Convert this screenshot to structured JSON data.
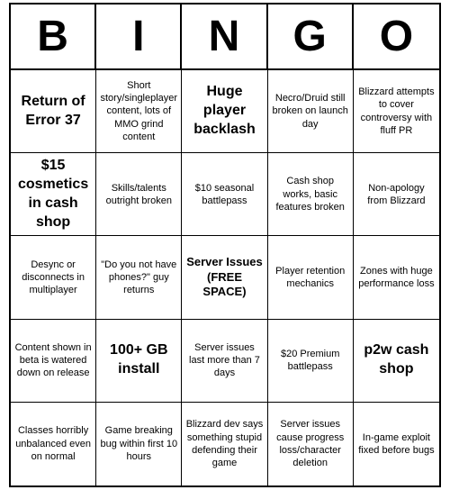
{
  "header": {
    "letters": [
      "B",
      "I",
      "N",
      "G",
      "O"
    ]
  },
  "cells": [
    {
      "text": "Return of Error 37",
      "large": true
    },
    {
      "text": "Short story/singleplayer content, lots of MMO grind content",
      "large": false
    },
    {
      "text": "Huge player backlash",
      "large": true
    },
    {
      "text": "Necro/Druid still broken on launch day",
      "large": false
    },
    {
      "text": "Blizzard attempts to cover controversy with fluff PR",
      "large": false
    },
    {
      "text": "$15 cosmetics in cash shop",
      "large": true
    },
    {
      "text": "Skills/talents outright broken",
      "large": false
    },
    {
      "text": "$10 seasonal battlepass",
      "large": false
    },
    {
      "text": "Cash shop works, basic features broken",
      "large": false
    },
    {
      "text": "Non-apology from Blizzard",
      "large": false
    },
    {
      "text": "Desync or disconnects in multiplayer",
      "large": false
    },
    {
      "text": "\"Do you not have phones?\" guy returns",
      "large": false
    },
    {
      "text": "Server Issues (FREE SPACE)",
      "large": false,
      "free": true
    },
    {
      "text": "Player retention mechanics",
      "large": false
    },
    {
      "text": "Zones with huge performance loss",
      "large": false
    },
    {
      "text": "Content shown in beta is watered down on release",
      "large": false
    },
    {
      "text": "100+ GB install",
      "large": true
    },
    {
      "text": "Server issues last more than 7 days",
      "large": false
    },
    {
      "text": "$20 Premium battlepass",
      "large": false
    },
    {
      "text": "p2w cash shop",
      "large": true
    },
    {
      "text": "Classes horribly unbalanced even on normal",
      "large": false
    },
    {
      "text": "Game breaking bug within first 10 hours",
      "large": false
    },
    {
      "text": "Blizzard dev says something stupid defending their game",
      "large": false
    },
    {
      "text": "Server issues cause progress loss/character deletion",
      "large": false
    },
    {
      "text": "In-game exploit fixed before bugs",
      "large": false
    }
  ]
}
